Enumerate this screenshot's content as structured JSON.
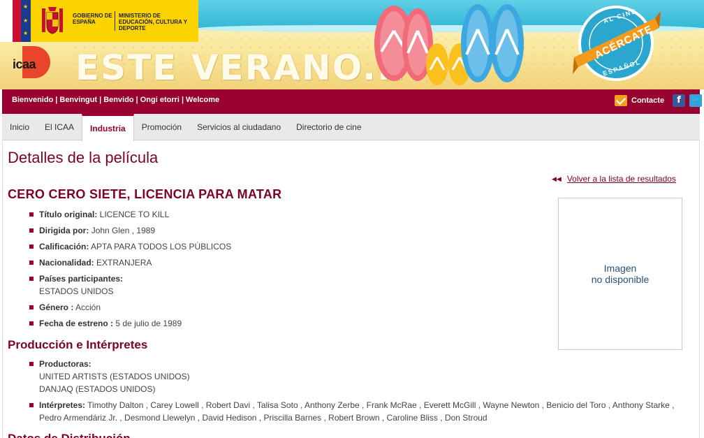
{
  "banner": {
    "gov_line1": "GOBIERNO DE ESPAÑA",
    "gov_line2": "MINISTERIO DE EDUCACIÓN, CULTURA Y DEPORTE",
    "icaa_logo_text": "icaa",
    "headline": "ESTE VERANO...",
    "seal_top": "AL CINE",
    "seal_ribbon": "ACÉRCATE",
    "seal_bottom": "ESPAÑOL"
  },
  "topbar": {
    "languages": [
      "Bienvenido",
      "Benvingut",
      "Benvido",
      "Ongi etorri",
      "Welcome"
    ],
    "contact_label": "Contacte"
  },
  "nav": {
    "items": [
      "Inicio",
      "El ICAA",
      "Industria",
      "Promoción",
      "Servicios al ciudadano",
      "Directorio de cine"
    ],
    "active": "Industria"
  },
  "page": {
    "title": "Detalles de la película",
    "back_link": "Volver a la lista de resultados"
  },
  "movie": {
    "title": "CERO CERO SIETE, LICENCIA PARA MATAR",
    "original_title_label": "Título original:",
    "original_title": "LICENCE TO KILL",
    "directed_label": "Dirigida por:",
    "directed": "John Glen , 1989",
    "rating_label": "Calificación:",
    "rating": "APTA PARA TODOS LOS PÚBLICOS",
    "nationality_label": "Nacionalidad:",
    "nationality": "EXTRANJERA",
    "countries_label": "Países participantes:",
    "countries": "ESTADOS UNIDOS",
    "genre_label": "Género :",
    "genre": "Acción",
    "release_label": "Fecha de estreno :",
    "release": "5 de julio de 1989",
    "image_placeholder_line1": "Imagen",
    "image_placeholder_line2": "no disponible"
  },
  "production": {
    "section_title": "Producción e Intérpretes",
    "producers_label": "Productoras:",
    "producers": [
      "UNITED ARTISTS (ESTADOS UNIDOS)",
      "DANJAQ (ESTADOS UNIDOS)"
    ],
    "cast_label": "Intérpretes:",
    "cast_line1": "Timothy Dalton , Carey Lowell , Robert Davi , Talisa Soto , Anthony Zerbe , Frank McRae , Everett McGill , Wayne Newton , Benicio del Toro , Anthony Starke ,",
    "cast_line2": "Pedro Armendáriz Jr. , Desmond Llewelyn , David Hedison , Priscilla Barnes , Robert Brown , Caroline Bliss , Don Stroud"
  },
  "distribution": {
    "section_title": "Datos de Distribución"
  }
}
